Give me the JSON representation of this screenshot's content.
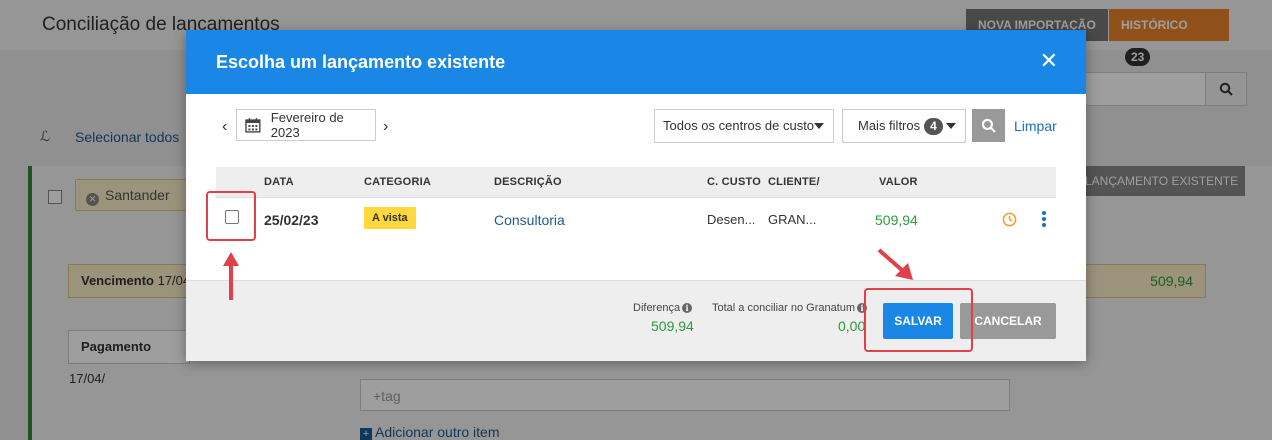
{
  "background": {
    "page_title": "Conciliação de lancamentos",
    "btn_nova_importacao": "NOVA IMPORTAÇÃO",
    "btn_historico": "HISTÓRICO",
    "historico_count": "23",
    "select_all": "Selecionar todos",
    "bank_chip": "Santander",
    "btn_lancamento_existente": "LANÇAMENTO EXISTENTE",
    "vencimento_label": "Vencimento",
    "vencimento_date": "17/04/",
    "vencimento_value": "509,94",
    "pagamento_label": "Pagamento",
    "pagamento_date": "17/04/",
    "tag_placeholder": "+tag",
    "add_item": "Adicionar outro item"
  },
  "modal": {
    "title": "Escolha um lançamento existente",
    "month": "Fevereiro de 2023",
    "cost_center": "Todos os centros de custo",
    "more_filters": "Mais filtros",
    "more_filters_count": "4",
    "clear": "Limpar",
    "columns": {
      "date": "DATA",
      "category": "CATEGORIA",
      "description": "DESCRIÇÃO",
      "cost_center": "C. CUSTO",
      "client": "CLIENTE/",
      "value": "VALOR"
    },
    "rows": [
      {
        "date": "25/02/23",
        "category": "A vista",
        "description": "Consultoria",
        "cost_center": "Desen...",
        "client": "GRAN...",
        "value": "509,94"
      }
    ],
    "footer": {
      "difference_label": "Diferença",
      "difference_value": "509,94",
      "total_label": "Total a conciliar no Granatum",
      "total_value": "0,00",
      "save": "SALVAR",
      "cancel": "CANCELAR"
    }
  },
  "colors": {
    "header_blue": "#1a86e6",
    "positive_green": "#2e9a3e",
    "category_yellow": "#ffd83b",
    "annotation_red": "#e0404a"
  }
}
